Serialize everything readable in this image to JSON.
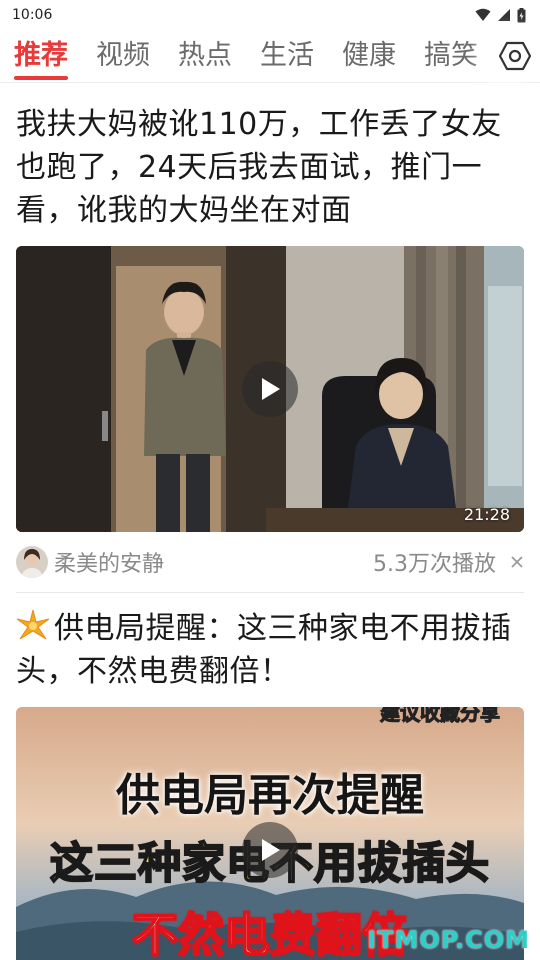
{
  "status_bar": {
    "time": "10:06"
  },
  "tabs": [
    {
      "label": "推荐",
      "active": true
    },
    {
      "label": "视频",
      "active": false
    },
    {
      "label": "热点",
      "active": false
    },
    {
      "label": "生活",
      "active": false
    },
    {
      "label": "健康",
      "active": false
    },
    {
      "label": "搞笑",
      "active": false
    }
  ],
  "accent_color": "#e93a3a",
  "feed": [
    {
      "title": "我扶大妈被讹110万，工作丢了女友也跑了，24天后我去面试，推门一看，讹我的大妈坐在对面",
      "duration": "21:28",
      "author": "柔美的安静",
      "views": "5.3万次播放"
    },
    {
      "title": "供电局提醒：这三种家电不用拔插头，不然电费翻倍！",
      "title_icon": "sparkle-icon",
      "thumbnail_text": {
        "top_banner": "建议收藏分享",
        "line1": "供电局再次提醒",
        "line2": "这三种家电不用拔插头",
        "line3": "不然电费翻倍"
      }
    }
  ],
  "watermark": "ITMOP.COM"
}
